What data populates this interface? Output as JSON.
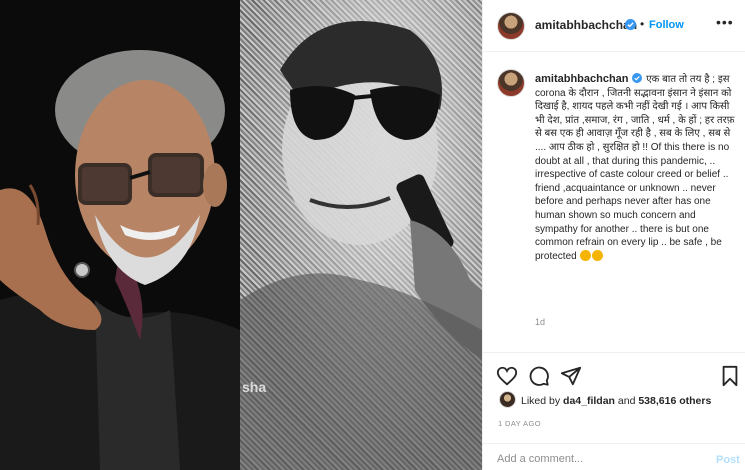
{
  "post": {
    "username": "amitabhbachchan",
    "dot": "•",
    "follow_label": "Follow",
    "more_label": "•••",
    "watermark": "sha",
    "caption_text": "एक बात तो तय है ; इस corona के दौरान , जितनी सद्भावना इंसान ने इंसान को दिखाई है, शायद पहले कभी नहीं देखी गई । आप किसी भी देश, प्रांत ,समाज, रंग , जाति , धर्म , के हों ; हर तरफ़ से बस एक ही आवाज़ गूँज रही है , सब के लिए , सब से .... आप ठीक हो , सुरक्षित हो !! Of this there is no doubt at all , that during this pandemic, .. irrespective of caste colour creed or belief .. friend ,acquaintance or unknown .. never before and perhaps never after has one human shown so much concern and sympathy for another .. there is but one common refrain on every lip .. be safe , be protected",
    "caption_age": "1d",
    "liked_by_label": "Liked by",
    "liked_by_user": "da4_fildan",
    "and_label": "and",
    "others_count": "538,616 others",
    "timestamp": "1 DAY AGO",
    "comment_placeholder": "Add a comment...",
    "post_label": "Post"
  },
  "icons": {
    "verified": "verified-badge-icon",
    "like": "heart-icon",
    "comment": "comment-bubble-icon",
    "share": "paper-plane-icon",
    "save": "bookmark-icon",
    "emoji": "folded-hands-emoji"
  },
  "colors": {
    "link_blue": "#0095f6",
    "post_disabled": "#b2dffc",
    "muted": "#8e8e8e",
    "text": "#262626",
    "border": "#efefef"
  }
}
